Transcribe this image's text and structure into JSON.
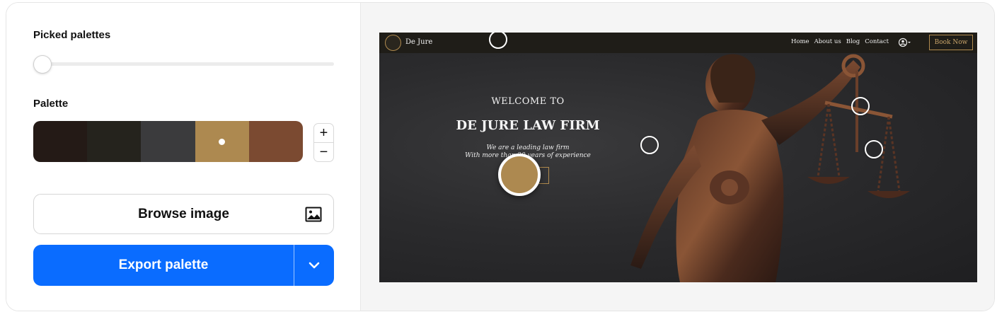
{
  "left_panel": {
    "picked_label": "Picked palettes",
    "palette_label": "Palette",
    "swatches": [
      {
        "color": "#241a16"
      },
      {
        "color": "#25231d"
      },
      {
        "color": "#3b3b3d"
      },
      {
        "color": "#ad8950"
      },
      {
        "color": "#7b4a31"
      }
    ],
    "plus_label": "+",
    "minus_label": "−",
    "browse_label": "Browse image",
    "browse_icon": "image-icon",
    "export_label": "Export palette",
    "export_dropdown_icon": "chevron-down-icon",
    "accent_color": "#0a6cff"
  },
  "preview": {
    "brand": "De Jure",
    "nav": {
      "home": "Home",
      "about": "About us",
      "blog": "Blog",
      "contact": "Contact"
    },
    "book_label": "Book Now",
    "hero": {
      "welcome": "WELCOME TO",
      "title": "DE JURE LAW FIRM",
      "sub1": "We are a leading law firm",
      "sub2": "With more than 20 years of experience"
    },
    "active_color": "#ad8950"
  }
}
